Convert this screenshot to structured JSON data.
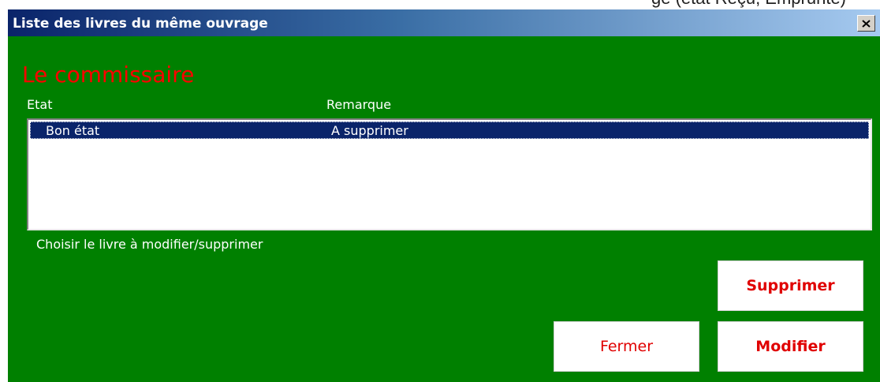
{
  "top_fragment": "ge (état Reçu, Emprunté)",
  "dialog": {
    "title": "Liste des livres du même ouvrage",
    "close_label": "×",
    "book_title": "Le commissaire",
    "columns": [
      "Etat",
      "Remarque"
    ],
    "rows": [
      {
        "etat": "Bon état",
        "remarque": "A supprimer",
        "selected": true
      }
    ],
    "hint": "Choisir le livre à modifier/supprimer",
    "buttons": {
      "delete": "Supprimer",
      "close": "Fermer",
      "edit": "Modifier"
    }
  },
  "colors": {
    "background": "#008000",
    "title_red": "#ff0000",
    "selection": "#0a246a",
    "titlebar_start": "#0a246a",
    "titlebar_end": "#a6caf0"
  }
}
